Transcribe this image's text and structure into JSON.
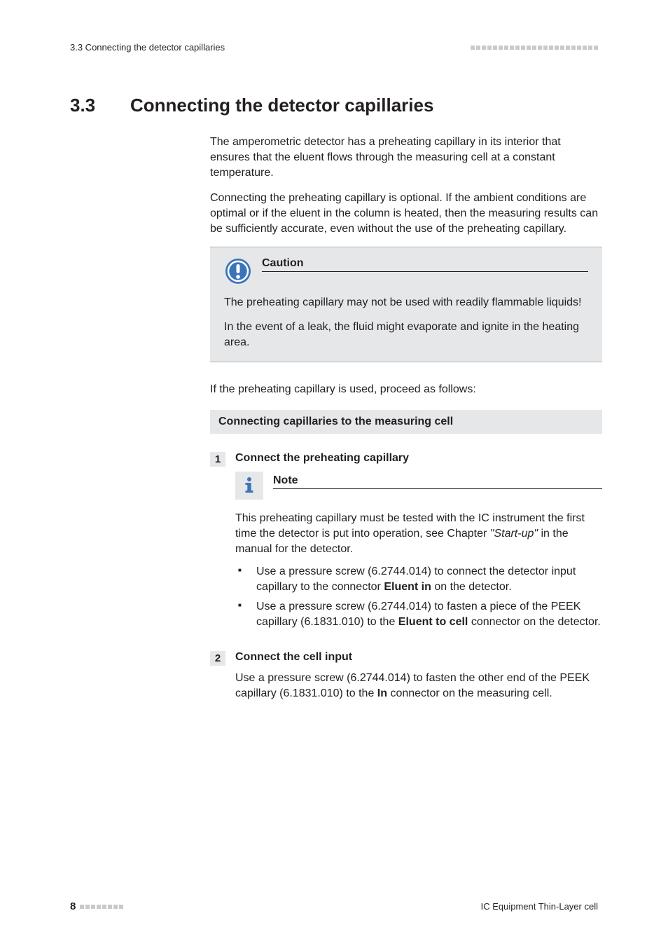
{
  "header": {
    "left": "3.3 Connecting the detector capillaries"
  },
  "section": {
    "number": "3.3",
    "title": "Connecting the detector capillaries"
  },
  "paras": {
    "p1": "The amperometric detector has a preheating capillary in its interior that ensures that the eluent flows through the measuring cell at a constant temperature.",
    "p2": "Connecting the preheating capillary is optional. If the ambient conditions are optimal or if the eluent in the column is heated, then the measuring results can be sufficiently accurate, even without the use of the preheating capillary."
  },
  "caution": {
    "title": "Caution",
    "p1": "The preheating capillary may not be used with readily flammable liquids!",
    "p2": "In the event of a leak, the fluid might evaporate and ignite in the heating area."
  },
  "lead": "If the preheating capillary is used, proceed as follows:",
  "subhead": "Connecting capillaries to the measuring cell",
  "step1": {
    "num": "1",
    "title": "Connect the preheating capillary",
    "note_title": "Note",
    "note_body_pre": "This preheating capillary must be tested with the IC instrument the first time the detector is put into operation, see Chapter ",
    "note_body_em": "\"Start-up\"",
    "note_body_post": " in the manual for the detector.",
    "bullet1_a": "Use a pressure screw (6.2744.014) to connect the detector input capillary to the connector ",
    "bullet1_b": "Eluent in",
    "bullet1_c": " on the detector.",
    "bullet2_a": "Use a pressure screw (6.2744.014) to fasten a piece of the PEEK capillary (6.1831.010) to the ",
    "bullet2_b": "Eluent to cell",
    "bullet2_c": " connector on the detector."
  },
  "step2": {
    "num": "2",
    "title": "Connect the cell input",
    "body_a": "Use a pressure screw (6.2744.014) to fasten the other end of the PEEK capillary (6.1831.010) to the ",
    "body_b": "In",
    "body_c": " connector on the measuring cell."
  },
  "footer": {
    "page": "8",
    "right": "IC Equipment Thin-Layer cell"
  }
}
